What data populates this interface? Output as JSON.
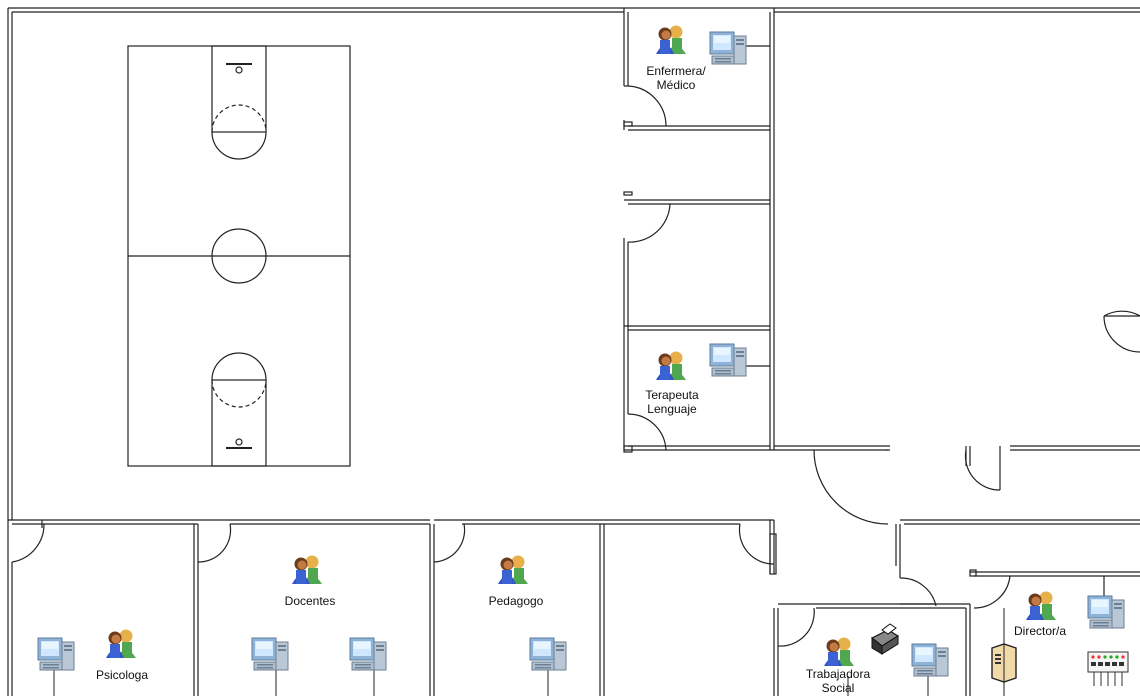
{
  "rooms": {
    "nurse": "Enfermera/\nMédico",
    "speech": "Terapeuta\nLenguaje",
    "psychologist": "Psicologa",
    "teachers": "Docentes",
    "pedagogue": "Pedagogo",
    "social_worker": "Trabajadora\nSocial",
    "director": "Director/a"
  },
  "icons": {
    "people": "people-icon",
    "workstation": "computer-icon",
    "server": "server-icon",
    "printer": "printer-icon",
    "switch": "network-switch-icon"
  }
}
